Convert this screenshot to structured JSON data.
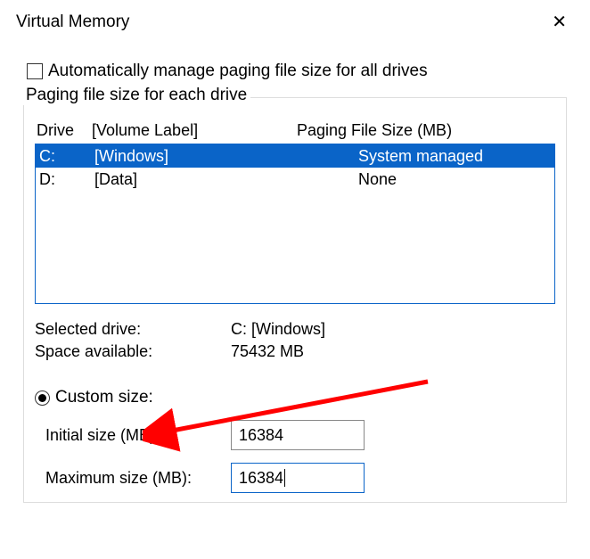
{
  "title": "Virtual Memory",
  "auto_checkbox_label": "Automatically manage paging file size for all drives",
  "auto_checked": false,
  "group_legend": "Paging file size for each drive",
  "headers": {
    "drive": "Drive",
    "label": "[Volume Label]",
    "size": "Paging File Size (MB)"
  },
  "drives": [
    {
      "letter": "C:",
      "label": "[Windows]",
      "size": "System managed",
      "selected": true
    },
    {
      "letter": "D:",
      "label": "[Data]",
      "size": "None",
      "selected": false
    }
  ],
  "info": {
    "selected_label": "Selected drive:",
    "selected_value": "C:  [Windows]",
    "space_label": "Space available:",
    "space_value": "75432 MB"
  },
  "radio": {
    "custom_label": "Custom size:",
    "custom_selected": true
  },
  "sizes": {
    "initial_label": "Initial size (MB):",
    "initial_value": "16384",
    "max_label": "Maximum size (MB):",
    "max_value": "16384"
  }
}
